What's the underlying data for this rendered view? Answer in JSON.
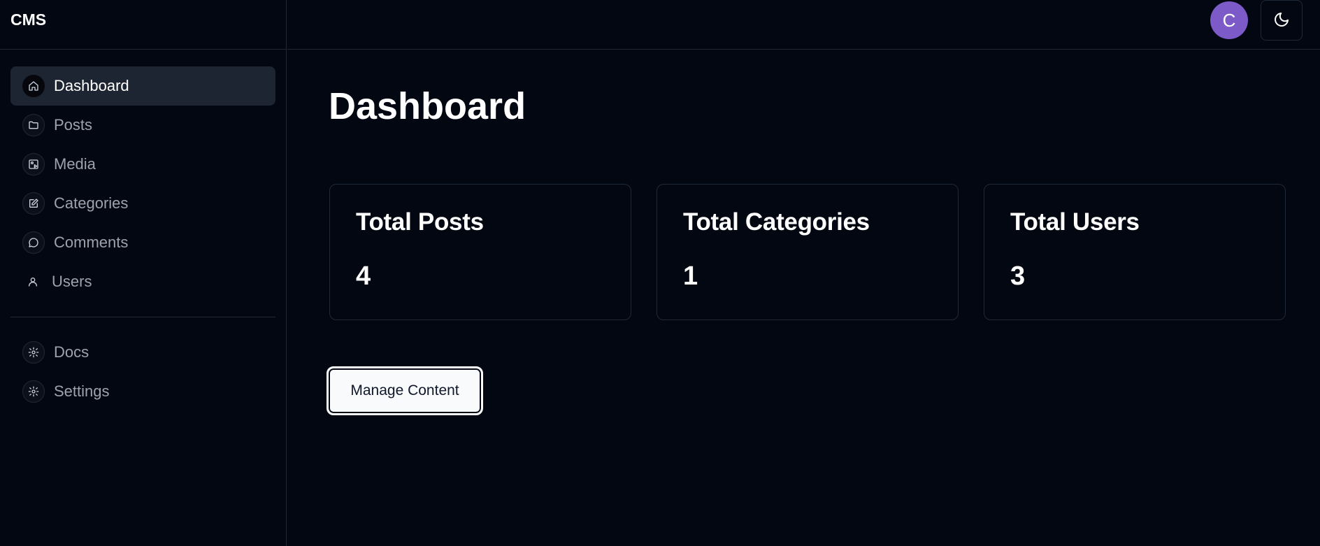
{
  "brand": "CMS",
  "sidebar": {
    "items": [
      {
        "label": "Dashboard",
        "icon": "home-icon",
        "active": true
      },
      {
        "label": "Posts",
        "icon": "folder-icon"
      },
      {
        "label": "Media",
        "icon": "image-play-icon"
      },
      {
        "label": "Categories",
        "icon": "edit-square-icon"
      },
      {
        "label": "Comments",
        "icon": "message-circle-icon"
      },
      {
        "label": "Users",
        "icon": "user-icon"
      }
    ],
    "secondary": [
      {
        "label": "Docs",
        "icon": "gear-icon"
      },
      {
        "label": "Settings",
        "icon": "gear-icon"
      }
    ]
  },
  "header": {
    "avatar_initial": "C",
    "avatar_color": "#7c5ac8",
    "theme_toggle_icon": "moon-icon"
  },
  "main": {
    "title": "Dashboard",
    "stats": [
      {
        "label": "Total Posts",
        "value": "4"
      },
      {
        "label": "Total Categories",
        "value": "1"
      },
      {
        "label": "Total Users",
        "value": "3"
      }
    ],
    "manage_button_label": "Manage Content"
  }
}
